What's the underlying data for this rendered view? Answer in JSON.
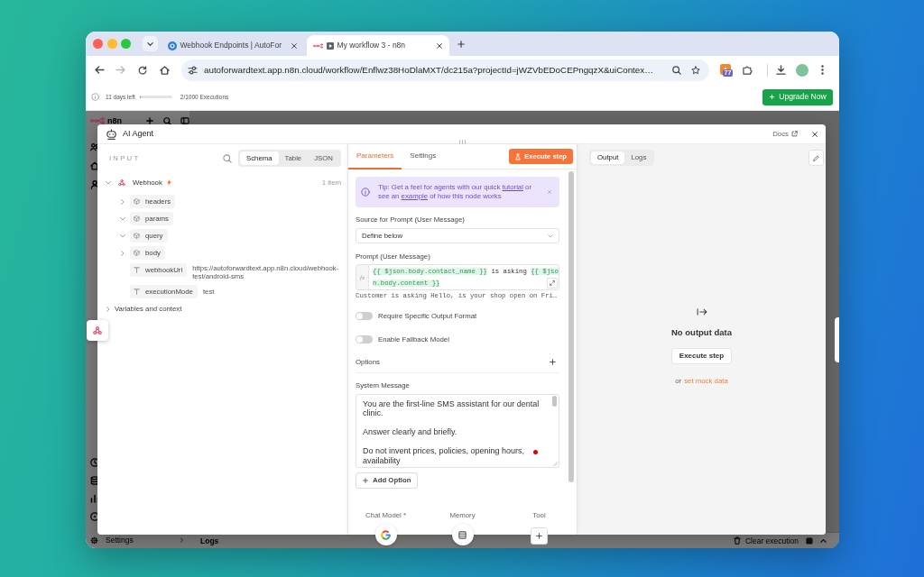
{
  "browser": {
    "tabs": [
      {
        "title": "Webhook Endpoints | AutoFor",
        "kind": "site",
        "media": false,
        "selected": false
      },
      {
        "title": "My workflow 3 - n8n",
        "kind": "workflow",
        "media": true,
        "selected": true
      }
    ],
    "can_go_back": true,
    "can_go_forward": false,
    "url": "autoforwardtext.app.n8n.cloud/workflow/Enflwz38HoDlaMXT/dc215a?projectId=jWZVbEDoCEPngqzX&uiContex…",
    "extension_badge": "77"
  },
  "trial_bar": {
    "days_left": "11 days left",
    "usage": {
      "level": 0.04
    },
    "executions": "2/1000 Executions",
    "upgrade_button": "Upgrade Now"
  },
  "app": {
    "logo": "n8n",
    "sidebar_footer": "Settings",
    "logs_panel": {
      "title": "Logs",
      "clear_button": "Clear execution"
    }
  },
  "node_panel": {
    "title": "AI Agent",
    "docs_link": "Docs",
    "input": {
      "heading": "INPUT",
      "view_tabs": [
        {
          "label": "Schema",
          "selected": true
        },
        {
          "label": "Table",
          "selected": false
        },
        {
          "label": "JSON",
          "selected": false
        }
      ],
      "tree": [
        {
          "kind": "node",
          "label": "Webhook",
          "trigger": true,
          "count": "1 item",
          "expanded": true,
          "children": [
            {
              "kind": "object",
              "label": "headers",
              "expanded": false
            },
            {
              "kind": "object",
              "label": "params",
              "expanded": true
            },
            {
              "kind": "object",
              "label": "query",
              "expanded": true
            },
            {
              "kind": "object",
              "label": "body",
              "expanded": false
            },
            {
              "kind": "string",
              "label": "webhookUrl",
              "value": "https://autoforwardtext.app.n8n.cloud/webhook-test/android-sms"
            },
            {
              "kind": "string",
              "label": "executionMode",
              "value": "test"
            }
          ]
        },
        {
          "kind": "section",
          "label": "Variables and context",
          "expanded": false
        }
      ]
    },
    "parameters": {
      "tabs": [
        {
          "label": "Parameters",
          "selected": true
        },
        {
          "label": "Settings",
          "selected": false
        }
      ],
      "execute_button": "Execute step",
      "tip": [
        {
          "kind": "text",
          "text": "Tip: Get a feel for agents with our quick "
        },
        {
          "kind": "link",
          "text": "tutorial"
        },
        {
          "kind": "text",
          "text": " or see an "
        },
        {
          "kind": "link",
          "text": "example"
        },
        {
          "kind": "text",
          "text": " of how this node works"
        }
      ],
      "source": {
        "label": "Source for Prompt (User Message)",
        "value": "Define below"
      },
      "prompt": {
        "label": "Prompt (User Message)",
        "gutter": "fx",
        "segments": [
          {
            "kind": "expression",
            "text": "{{ $json.body.contact_name }}"
          },
          {
            "kind": "plain",
            "text": " is asking "
          },
          {
            "kind": "expression",
            "text": "{{ $json.body.content }}"
          }
        ],
        "result": "Customer is asking Hello, is your shop open on Fri…"
      },
      "toggles": [
        {
          "label": "Require Specific Output Format",
          "on": false
        },
        {
          "label": "Enable Fallback Model",
          "on": false
        }
      ],
      "options_label": "Options",
      "system_message": {
        "label": "System Message",
        "value": "You are the first-line SMS assistant for our dental clinic.\n\nAnswer clearly and briefly.\n\nDo not invent prices, policies, opening hours, availability"
      },
      "add_option_button": "Add Option",
      "connections": [
        {
          "kind": "model",
          "label": "Chat Model *"
        },
        {
          "kind": "memory",
          "label": "Memory"
        },
        {
          "kind": "add",
          "label": "Tool"
        }
      ]
    },
    "output": {
      "tabs": [
        {
          "label": "Output",
          "selected": true
        },
        {
          "label": "Logs",
          "selected": false
        }
      ],
      "empty_title": "No output data",
      "execute_button": "Execute step",
      "hint": "or",
      "mock_link": "set mock data"
    }
  }
}
